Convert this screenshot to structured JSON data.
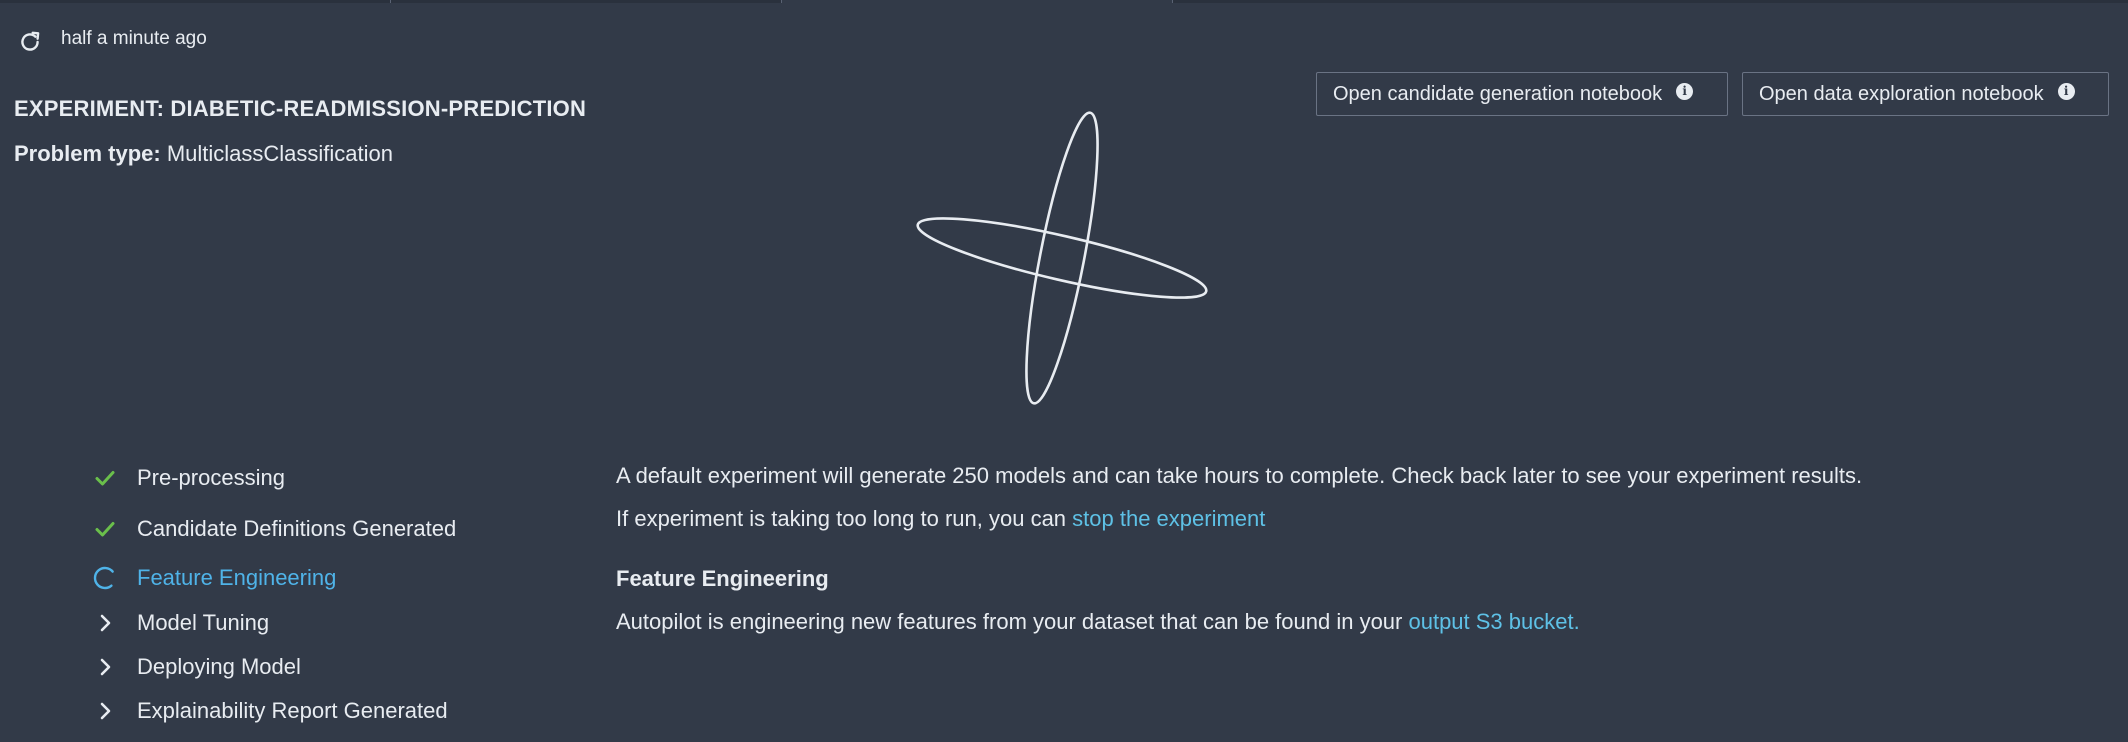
{
  "header": {
    "refresh_time": "half a minute ago"
  },
  "experiment": {
    "title": "EXPERIMENT: DIABETIC-READMISSION-PREDICTION",
    "problem_type_label": "Problem type:",
    "problem_type_value": "MulticlassClassification"
  },
  "notebooks": {
    "candidate_label": "Open candidate generation notebook",
    "exploration_label": "Open data exploration notebook"
  },
  "steps": [
    {
      "label": "Pre-processing",
      "status": "complete",
      "icon": "check-icon"
    },
    {
      "label": "Candidate Definitions Generated",
      "status": "complete",
      "icon": "check-icon"
    },
    {
      "label": "Feature Engineering",
      "status": "in-progress",
      "icon": "spinner-icon"
    },
    {
      "label": "Model Tuning",
      "status": "pending",
      "icon": "chevron-right-icon"
    },
    {
      "label": "Deploying Model",
      "status": "pending",
      "icon": "chevron-right-icon"
    },
    {
      "label": "Explainability Report Generated",
      "status": "pending",
      "icon": "chevron-right-icon"
    }
  ],
  "messages": {
    "default_info": "A default experiment will generate 250 models and can take hours to complete. Check back later to see your experiment results.",
    "stop_prefix": "If experiment is taking too long to run, you can ",
    "stop_link": "stop the experiment",
    "current_step_title": "Feature Engineering",
    "current_step_desc": "Autopilot is engineering new features from your dataset that can be found in your ",
    "current_step_link": "output S3 bucket."
  },
  "colors": {
    "background": "#323a48",
    "accent": "#4fb3e8",
    "link": "#5ec1e6",
    "success": "#6abf4b"
  }
}
